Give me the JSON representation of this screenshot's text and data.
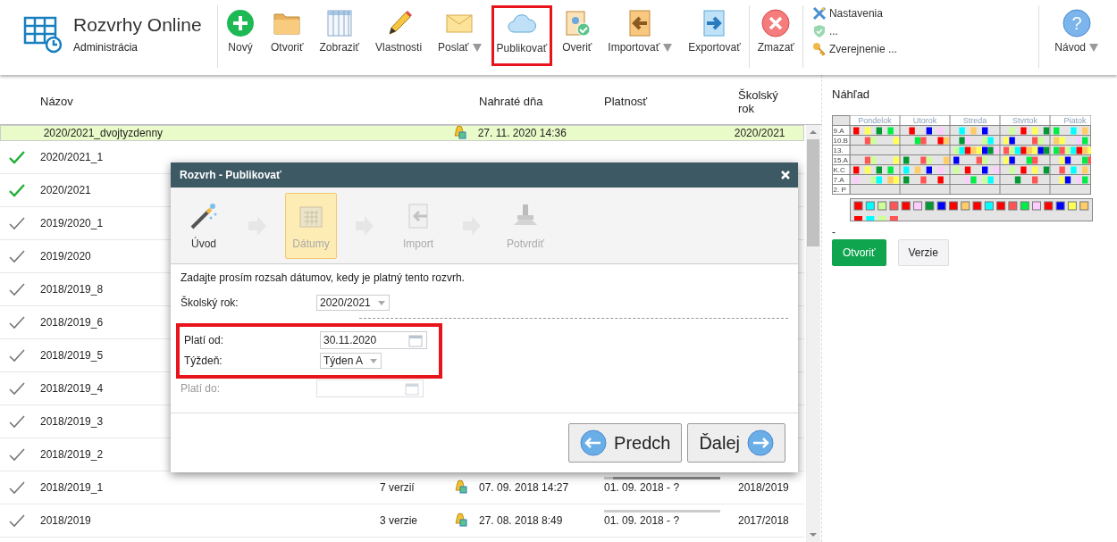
{
  "app": {
    "title": "Rozvrhy Online",
    "subtitle": "Administrácia"
  },
  "toolbar": [
    {
      "kind": "new",
      "label": "Nový",
      "dropdown": false,
      "highlighted": false
    },
    {
      "kind": "open",
      "label": "Otvoriť",
      "dropdown": false,
      "highlighted": false
    },
    {
      "kind": "view",
      "label": "Zobraziť",
      "dropdown": false,
      "highlighted": false
    },
    {
      "kind": "properties",
      "label": "Vlastnosti",
      "dropdown": false,
      "highlighted": false
    },
    {
      "kind": "send",
      "label": "Poslať",
      "dropdown": true,
      "highlighted": false
    },
    {
      "kind": "publish",
      "label": "Publikovať",
      "dropdown": false,
      "highlighted": true
    },
    {
      "kind": "verify",
      "label": "Overiť",
      "dropdown": false,
      "highlighted": false
    },
    {
      "kind": "import",
      "label": "Importovať",
      "dropdown": true,
      "highlighted": false
    },
    {
      "kind": "export",
      "label": "Exportovať",
      "dropdown": false,
      "highlighted": false
    },
    {
      "kind": "delete",
      "label": "Zmazať",
      "dropdown": false,
      "highlighted": false
    }
  ],
  "toolbar_links": [
    {
      "kind": "settings",
      "label": "Nastavenia"
    },
    {
      "kind": "shield",
      "label": "..."
    },
    {
      "kind": "key",
      "label": "Zverejnenie ..."
    }
  ],
  "help": {
    "icon": "?",
    "label": "Návod",
    "dropdown": true
  },
  "table": {
    "columns": [
      "Názov",
      "Nahraté dňa",
      "Platnosť",
      "Školský rok"
    ],
    "rows": [
      {
        "checked": false,
        "name": "2020/2021_dvojtyzdenny",
        "selected": true,
        "shared": true,
        "uploaded": "27. 11. 2020 14:36",
        "year": "2020/2021"
      },
      {
        "checked": true,
        "current": true,
        "name": "2020/2021_1",
        "selected": false
      },
      {
        "checked": true,
        "current": true,
        "name": "2020/2021",
        "selected": false
      },
      {
        "checked": true,
        "current": false,
        "name": "2019/2020_1",
        "selected": false
      },
      {
        "checked": true,
        "current": false,
        "name": "2019/2020",
        "selected": false
      },
      {
        "checked": true,
        "current": false,
        "name": "2018/2019_8",
        "selected": false
      },
      {
        "checked": true,
        "current": false,
        "name": "2018/2019_6",
        "selected": false
      },
      {
        "checked": true,
        "current": false,
        "name": "2018/2019_5",
        "selected": false
      },
      {
        "checked": true,
        "current": false,
        "name": "2018/2019_4",
        "selected": false
      },
      {
        "checked": true,
        "current": false,
        "name": "2018/2019_3",
        "selected": false
      },
      {
        "checked": true,
        "current": false,
        "name": "2018/2019_2",
        "selected": false
      },
      {
        "checked": true,
        "current": false,
        "name": "2018/2019_1",
        "selected": false,
        "versions": "7 verzií",
        "shared": true,
        "uploaded": "07. 09. 2018 14:27",
        "validity": "01. 09. 2018 - ?",
        "level": 0.92,
        "year": "2018/2019"
      },
      {
        "checked": true,
        "current": false,
        "name": "2018/2019",
        "selected": false,
        "versions": "3 verzie",
        "shared": true,
        "uploaded": "27. 08. 2018 8:49",
        "validity": "01. 09. 2018 - ?",
        "level": 0,
        "year": "2017/2018"
      }
    ]
  },
  "preview": {
    "title": "Náhľad",
    "days": [
      "Pondelok",
      "Utorok",
      "Streda",
      "Stvrtok",
      "Piatok"
    ],
    "classes": [
      "9.A",
      "10.B",
      "13.",
      "15.A",
      "K.C",
      "7.A",
      "2. P"
    ],
    "note": "-",
    "buttons": [
      {
        "label": "Otvoriť",
        "primary": true
      },
      {
        "label": "Verzie",
        "primary": false
      }
    ]
  },
  "dialog": {
    "title": "Rozvrh - Publikovať",
    "steps": [
      {
        "kind": "intro",
        "label": "Úvod",
        "selected": false,
        "disabled": false
      },
      {
        "kind": "dates",
        "label": "Dátumy",
        "selected": true,
        "disabled": true
      },
      {
        "kind": "import",
        "label": "Import",
        "selected": false,
        "disabled": true
      },
      {
        "kind": "confirm",
        "label": "Potvrdiť",
        "selected": false,
        "disabled": true
      }
    ],
    "instruction": "Zadajte prosím rozsah dátumov, kedy je platný tento rozvrh.",
    "school_year": {
      "label": "Školský rok:",
      "value": "2020/2021"
    },
    "highlighted": true,
    "valid_from": {
      "label": "Platí od:",
      "value": "30.11.2020",
      "disabled": false
    },
    "week": {
      "label": "Týždeň:",
      "value": "Týden A"
    },
    "valid_to": {
      "label": "Platí do:",
      "disabled": true
    },
    "buttons": [
      {
        "kind": "back",
        "label": "Predch"
      },
      {
        "kind": "next",
        "label": "Ďalej"
      }
    ]
  }
}
